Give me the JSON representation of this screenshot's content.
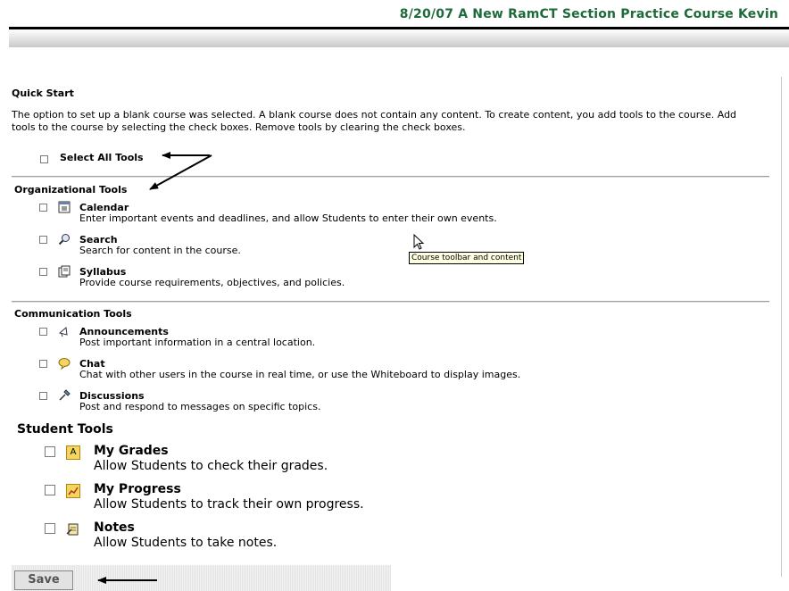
{
  "header": {
    "title": "8/20/07 A New RamCT Section Practice Course Kevin",
    "title_color": "#1e6b3a"
  },
  "quick_start": {
    "heading": "Quick Start",
    "description": "The option to set up a blank course was selected. A blank course does not contain any content. To create content, you add tools to the course. Add tools to the course by selecting the check boxes. Remove tools by clearing the check boxes.",
    "select_all_label": "Select All Tools"
  },
  "organizational": {
    "title": "Organizational Tools",
    "tools": [
      {
        "name": "Calendar",
        "desc": "Enter important events and deadlines, and allow Students to enter their own events.",
        "icon": "calendar-icon"
      },
      {
        "name": "Search",
        "desc": "Search for content in the course.",
        "icon": "search-icon"
      },
      {
        "name": "Syllabus",
        "desc": "Provide course requirements, objectives, and policies.",
        "icon": "syllabus-icon"
      }
    ]
  },
  "communication": {
    "title": "Communication Tools",
    "tools": [
      {
        "name": "Announcements",
        "desc": "Post important information in a central location.",
        "icon": "announcements-icon"
      },
      {
        "name": "Chat",
        "desc": "Chat with other users in the course in real time, or use the Whiteboard to display images.",
        "icon": "chat-icon"
      },
      {
        "name": "Discussions",
        "desc": "Post and respond to messages on specific topics.",
        "icon": "discussions-icon"
      }
    ]
  },
  "student": {
    "title": "Student Tools",
    "tools": [
      {
        "name": "My Grades",
        "desc": "Allow Students to check their grades.",
        "icon": "grades-icon"
      },
      {
        "name": "My Progress",
        "desc": "Allow Students to track their own progress.",
        "icon": "progress-icon"
      },
      {
        "name": "Notes",
        "desc": "Allow Students to take notes.",
        "icon": "notes-icon"
      }
    ]
  },
  "tooltip": "Course toolbar and content",
  "save_label": "Save"
}
